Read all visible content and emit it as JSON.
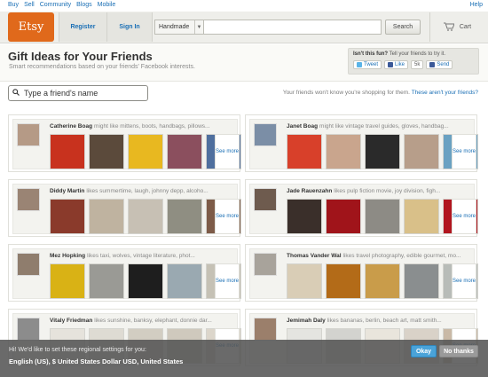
{
  "topbar": {
    "links": [
      "Buy",
      "Sell",
      "Community",
      "Blogs",
      "Mobile"
    ],
    "help": "Help"
  },
  "header": {
    "logo": "Etsy",
    "register": "Register",
    "signin": "Sign In",
    "search_category": "Handmade",
    "search_value": "",
    "search_button": "Search",
    "cart": "Cart"
  },
  "page": {
    "title": "Gift Ideas for Your Friends",
    "subtitle": "Smart recommendations based on your friends' Facebook interests."
  },
  "share": {
    "bold": "Isn't this fun?",
    "text": " Tell your friends to try it.",
    "tweet": "Tweet",
    "like": "Like",
    "count": "5k",
    "send": "Send"
  },
  "friend_search": {
    "placeholder": "Type a friend's name"
  },
  "privacy": {
    "text": "Your friends won't know you're shopping for them. ",
    "link": "These aren't your friends?"
  },
  "see_more": "See more",
  "friends": [
    {
      "name": "Catherine Boag",
      "likes": "might like mittens, boots, handbags, pillows...",
      "avatar": "#b59a86",
      "thumbs": [
        "#c8321e",
        "#5b4a3b",
        "#e8b820",
        "#8b4f5e",
        "#4f6f9e"
      ]
    },
    {
      "name": "Janet Boag",
      "likes": "might like vintage travel guides, gloves, handbag...",
      "avatar": "#7b8ea6",
      "thumbs": [
        "#d8402a",
        "#c9a58d",
        "#2a2a2a",
        "#b79e8a",
        "#6aa1c2"
      ]
    },
    {
      "name": "Diddy Martin",
      "likes": "likes summertime, laugh, johnny depp, alcoho...",
      "avatar": "#9a8474",
      "thumbs": [
        "#8a3a2b",
        "#bfb3a0",
        "#c7c0b4",
        "#8f8e82",
        "#7d5b48"
      ]
    },
    {
      "name": "Jade Rauenzahn",
      "likes": "likes pulp fiction movie, joy division, figh...",
      "avatar": "#6e5b4e",
      "thumbs": [
        "#3a2f2a",
        "#a0141a",
        "#8d8b85",
        "#d9c089",
        "#b1151f"
      ]
    },
    {
      "name": "Mez Hopking",
      "likes": "likes taxi, wolves, vintage literature, phot...",
      "avatar": "#8f7d6d",
      "thumbs": [
        "#d9b215",
        "#9a9a95",
        "#1e1e1e",
        "#9aa9b1",
        "#c5c1b5"
      ]
    },
    {
      "name": "Thomas Vander Wal",
      "likes": "likes travel photography, edible gourmet, mo...",
      "avatar": "#a8a39b",
      "thumbs": [
        "#d9cdb6",
        "#b36b18",
        "#c99c4a",
        "#8a8e8f",
        "#b8bcb8"
      ]
    },
    {
      "name": "Vitaly Friedman",
      "likes": "likes sunshine, banksy, elephant, donnie dar...",
      "avatar": "#8c8c8c",
      "thumbs": [
        "#e6e3dc",
        "#dedbd3",
        "#d2cdc2",
        "#cfc9bd",
        "#dcd6cb"
      ]
    },
    {
      "name": "Jemimah Daly",
      "likes": "likes bananas, berlin, beach art, matt smith...",
      "avatar": "#9b7f6b",
      "thumbs": [
        "#e4e4e0",
        "#d3d3cf",
        "#e9e5dc",
        "#d9d2c8",
        "#c9b9a6"
      ]
    }
  ],
  "regional": {
    "prompt": "Hi! We'd like to set these regional settings for you:",
    "settings": "English (US), $ United States Dollar USD, United States",
    "okay": "Okay",
    "no_thanks": "No thanks"
  },
  "colors": {
    "accent": "#e0691b",
    "link": "#1a6fb5",
    "okay": "#4aa3d9"
  }
}
